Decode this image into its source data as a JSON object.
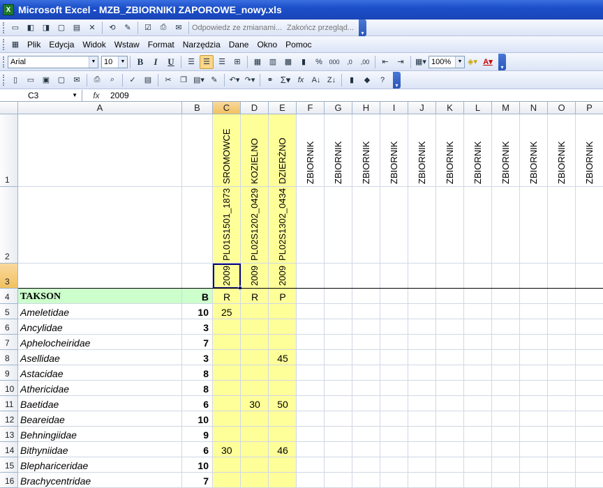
{
  "window": {
    "title": "Microsoft Excel - MZB_ZBIORNIKI ZAPOROWE_nowy.xls",
    "icon": "excel-icon"
  },
  "review_toolbar": {
    "reply_label": "Odpowiedz ze zmianami...",
    "end_review_label": "Zakończ przegląd..."
  },
  "menu": [
    "Plik",
    "Edycja",
    "Widok",
    "Wstaw",
    "Format",
    "Narzędzia",
    "Dane",
    "Okno",
    "Pomoc"
  ],
  "format_toolbar": {
    "font": "Arial",
    "size": "10",
    "zoom": "100%"
  },
  "formula_bar": {
    "name_box": "C3",
    "fx": "fx",
    "value": "2009"
  },
  "columns": [
    "A",
    "B",
    "C",
    "D",
    "E",
    "F",
    "G",
    "H",
    "I",
    "J",
    "K",
    "L",
    "M",
    "N",
    "O",
    "P"
  ],
  "active_column": "C",
  "active_row": "3",
  "row1": {
    "C": "SROMOWCE",
    "D": "KOZIELNO",
    "E": "DZIERŻNO",
    "rest": "ZBIORNIK"
  },
  "row2": {
    "C": "PL01S1501_1873",
    "D": "PL02S1202_0429",
    "E": "PL02S1302_0434"
  },
  "row3": {
    "C": "2009",
    "D": "2009",
    "E": "2009"
  },
  "header_row": {
    "num": "4",
    "A": "TAKSON",
    "B": "B",
    "C": "R",
    "D": "R",
    "E": "P"
  },
  "rows": [
    {
      "num": "5",
      "name": "Ameletidae",
      "b": "10",
      "c": "25",
      "d": "",
      "e": ""
    },
    {
      "num": "6",
      "name": "Ancylidae",
      "b": "3",
      "c": "",
      "d": "",
      "e": ""
    },
    {
      "num": "7",
      "name": "Aphelocheiridae",
      "b": "7",
      "c": "",
      "d": "",
      "e": ""
    },
    {
      "num": "8",
      "name": "Asellidae",
      "b": "3",
      "c": "",
      "d": "",
      "e": "45"
    },
    {
      "num": "9",
      "name": "Astacidae",
      "b": "8",
      "c": "",
      "d": "",
      "e": ""
    },
    {
      "num": "10",
      "name": "Athericidae",
      "b": "8",
      "c": "",
      "d": "",
      "e": ""
    },
    {
      "num": "11",
      "name": "Baetidae",
      "b": "6",
      "c": "",
      "d": "30",
      "e": "50"
    },
    {
      "num": "12",
      "name": "Beareidae",
      "b": "10",
      "c": "",
      "d": "",
      "e": ""
    },
    {
      "num": "13",
      "name": "Behningiidae",
      "b": "9",
      "c": "",
      "d": "",
      "e": ""
    },
    {
      "num": "14",
      "name": "Bithyniidae",
      "b": "6",
      "c": "30",
      "d": "",
      "e": "46"
    },
    {
      "num": "15",
      "name": "Blephariceridae",
      "b": "10",
      "c": "",
      "d": "",
      "e": ""
    },
    {
      "num": "16",
      "name": "Brachycentridae",
      "b": "7",
      "c": "",
      "d": "",
      "e": ""
    }
  ],
  "colors": {
    "highlight_yellow": "#ffff99",
    "header_green": "#ccffcc",
    "selection": "#000080"
  }
}
